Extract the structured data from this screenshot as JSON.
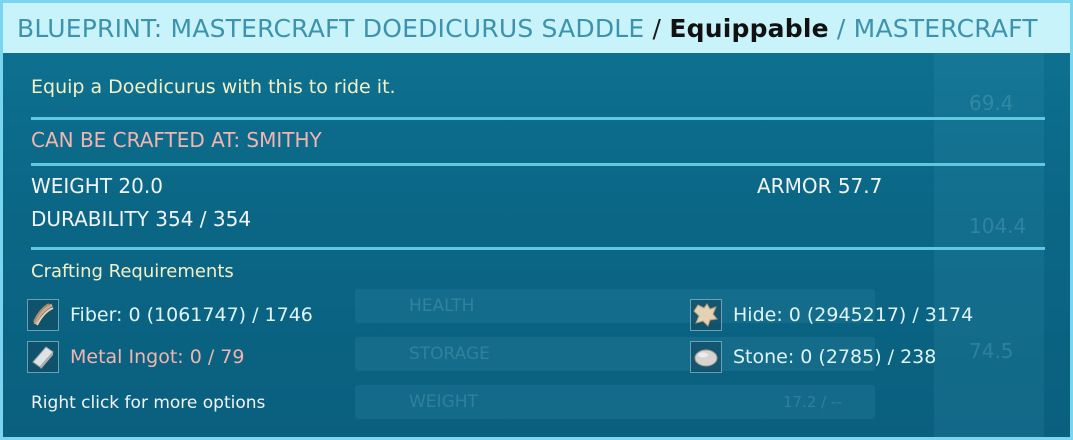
{
  "tooltip": {
    "title": {
      "name": "BLUEPRINT: MASTERCRAFT DOEDICURUS SADDLE",
      "sep1": " / ",
      "type": "Equippable",
      "sep2": " / ",
      "quality": "MASTERCRAFT"
    },
    "description": "Equip a Doedicurus with this to ride it.",
    "crafted_at": "CAN BE CRAFTED AT: SMITHY",
    "stats": {
      "weight": "WEIGHT 20.0",
      "armor": "ARMOR 57.7",
      "durability": "DURABILITY 354 / 354"
    },
    "requirements_title": "Crafting Requirements",
    "requirements": [
      {
        "icon": "fiber-icon",
        "text": "Fiber: 0 (1061747) / 1746",
        "status": "ok"
      },
      {
        "icon": "hide-icon",
        "text": "Hide: 0 (2945217) / 3174",
        "status": "ok"
      },
      {
        "icon": "metal-ingot-icon",
        "text": "Metal Ingot: 0 / 79",
        "status": "missing"
      },
      {
        "icon": "stone-icon",
        "text": "Stone: 0 (2785) / 238",
        "status": "ok"
      }
    ],
    "footer": "Right click for more options",
    "colors": {
      "title_bg": "#c9f3fb",
      "accent_text": "#3d93ad",
      "description": "#f4f0c6",
      "crafted_at": "#f2b5b0",
      "missing": "#f2b5b0",
      "border": "#79d6ee",
      "panel": "#0b6786"
    }
  },
  "background": {
    "stat_labels": [
      "HEALTH",
      "STORAGE",
      "WEIGHT"
    ],
    "values": [
      "69.4",
      "104.4",
      "74.5",
      "17.2 / --"
    ]
  }
}
